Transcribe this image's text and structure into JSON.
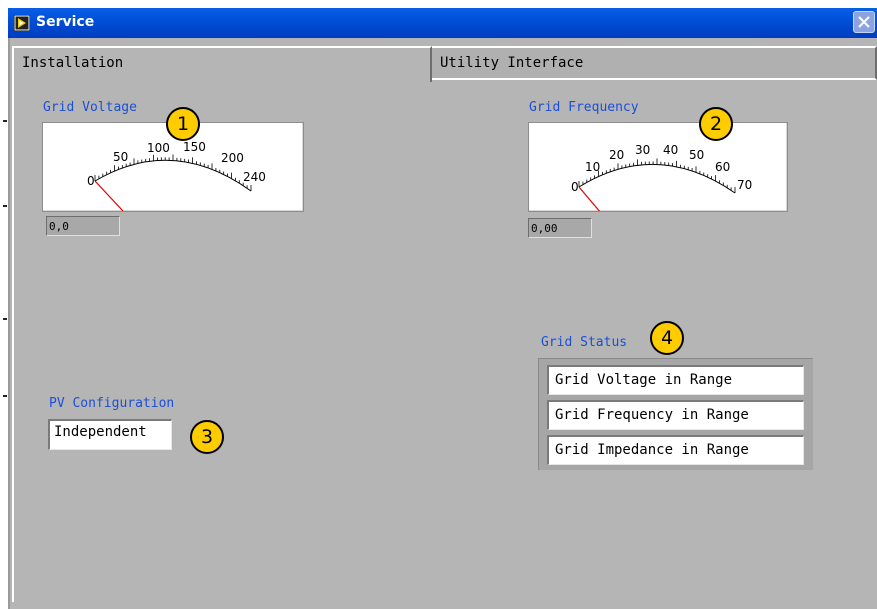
{
  "window": {
    "title": "Service"
  },
  "tabs": [
    {
      "label": "Installation",
      "active": true
    },
    {
      "label": "Utility Interface",
      "active": false
    }
  ],
  "grid_voltage": {
    "label": "Grid Voltage",
    "scale_labels": [
      "0",
      "50",
      "100",
      "150",
      "200",
      "240"
    ],
    "readout": "0,0",
    "callout": "1"
  },
  "grid_frequency": {
    "label": "Grid Frequency",
    "scale_labels": [
      "0",
      "10",
      "20",
      "30",
      "40",
      "50",
      "60",
      "70"
    ],
    "readout": "0,00",
    "callout": "2"
  },
  "pv_configuration": {
    "label": "PV Configuration",
    "value": "Independent",
    "callout": "3"
  },
  "grid_status": {
    "label": "Grid Status",
    "items": [
      "Grid Voltage in Range",
      "Grid Frequency in Range",
      "Grid Impedance in Range"
    ],
    "callout": "4"
  },
  "colors": {
    "title_bar": "#0050d8",
    "panel": "#b5b5b5",
    "label_blue": "#1a4fd6",
    "callout_fill": "#ffcc00",
    "needle": "#e00000"
  }
}
